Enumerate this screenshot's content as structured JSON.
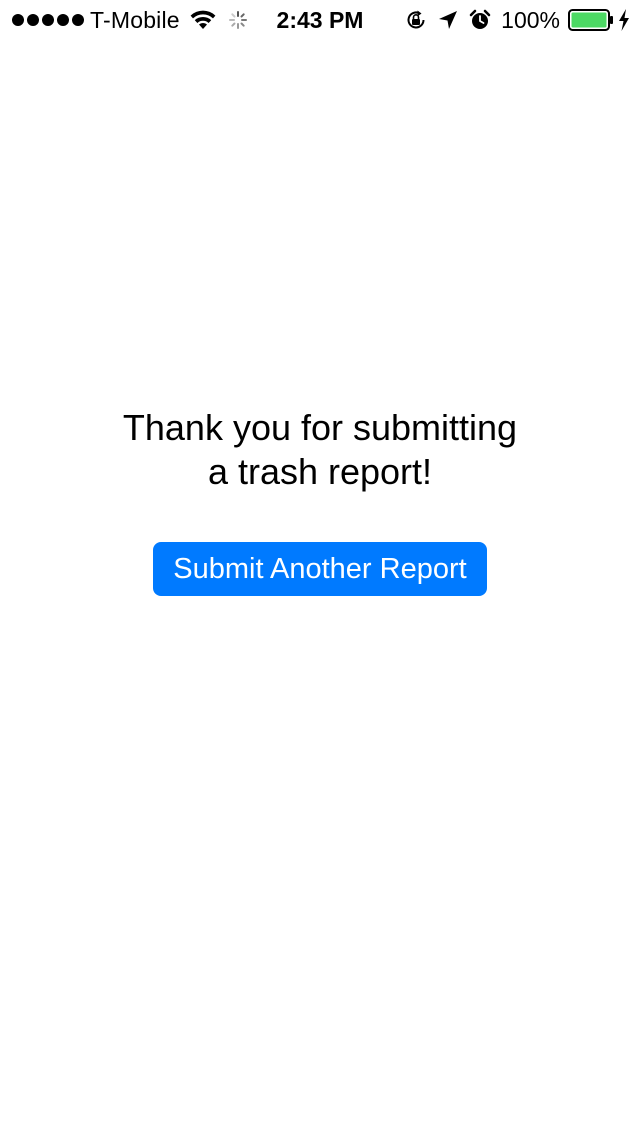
{
  "status_bar": {
    "signal_bars": 5,
    "carrier": "T-Mobile",
    "time": "2:43 PM",
    "battery_percent": "100%",
    "battery_level": 1.0,
    "battery_color": "#4cd964",
    "icons": [
      "wifi-icon",
      "activity-spinner-icon",
      "orientation-lock-icon",
      "location-arrow-icon",
      "alarm-icon",
      "battery-icon",
      "charging-bolt-icon"
    ]
  },
  "main": {
    "message_line1": "Thank you for submitting",
    "message_line2": "a trash report!",
    "submit_button_label": "Submit Another Report",
    "accent_color": "#007aff"
  }
}
